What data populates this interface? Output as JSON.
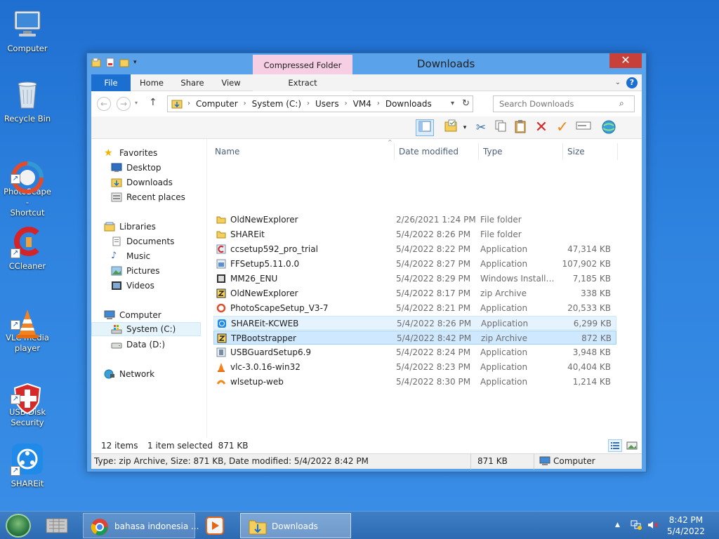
{
  "desktop": {
    "icons": [
      {
        "label": "Computer"
      },
      {
        "label": "Recycle Bin"
      },
      {
        "label": "PhotoScape -\nShortcut"
      },
      {
        "label": "CCleaner"
      },
      {
        "label": "VLC media\nplayer"
      },
      {
        "label": "USB Disk\nSecurity"
      },
      {
        "label": "SHAREit"
      }
    ]
  },
  "window": {
    "title": "Downloads",
    "context_tab": "Compressed Folder Tools",
    "tabs": {
      "file": "File",
      "home": "Home",
      "share": "Share",
      "view": "View",
      "extract": "Extract"
    },
    "help": "?",
    "close": "✕"
  },
  "address": {
    "crumbs": [
      "Computer",
      "System (C:)",
      "Users",
      "VM4",
      "Downloads"
    ],
    "search_placeholder": "Search Downloads"
  },
  "nav": {
    "favorites": "Favorites",
    "desktop": "Desktop",
    "downloads": "Downloads",
    "recent": "Recent places",
    "libraries": "Libraries",
    "documents": "Documents",
    "music": "Music",
    "pictures": "Pictures",
    "videos": "Videos",
    "computer": "Computer",
    "system_c": "System (C:)",
    "data_d": "Data (D:)",
    "network": "Network"
  },
  "columns": {
    "name": "Name",
    "date": "Date modified",
    "type": "Type",
    "size": "Size"
  },
  "files": [
    {
      "name": "OldNewExplorer",
      "date": "2/26/2021 1:24 PM",
      "type": "File folder",
      "size": ""
    },
    {
      "name": "SHAREit",
      "date": "5/4/2022 8:26 PM",
      "type": "File folder",
      "size": ""
    },
    {
      "name": "ccsetup592_pro_trial",
      "date": "5/4/2022 8:22 PM",
      "type": "Application",
      "size": "47,314 KB"
    },
    {
      "name": "FFSetup5.11.0.0",
      "date": "5/4/2022 8:27 PM",
      "type": "Application",
      "size": "107,902 KB"
    },
    {
      "name": "MM26_ENU",
      "date": "5/4/2022 8:29 PM",
      "type": "Windows Installer ...",
      "size": "7,185 KB"
    },
    {
      "name": "OldNewExplorer",
      "date": "5/4/2022 8:17 PM",
      "type": "zip Archive",
      "size": "338 KB"
    },
    {
      "name": "PhotoScapeSetup_V3-7",
      "date": "5/4/2022 8:21 PM",
      "type": "Application",
      "size": "20,533 KB"
    },
    {
      "name": "SHAREit-KCWEB",
      "date": "5/4/2022 8:26 PM",
      "type": "Application",
      "size": "6,299 KB"
    },
    {
      "name": "TPBootstrapper",
      "date": "5/4/2022 8:42 PM",
      "type": "zip Archive",
      "size": "872 KB"
    },
    {
      "name": "USBGuardSetup6.9",
      "date": "5/4/2022 8:24 PM",
      "type": "Application",
      "size": "3,948 KB"
    },
    {
      "name": "vlc-3.0.16-win32",
      "date": "5/4/2022 8:23 PM",
      "type": "Application",
      "size": "40,404 KB"
    },
    {
      "name": "wlsetup-web",
      "date": "5/4/2022 8:30 PM",
      "type": "Application",
      "size": "1,214 KB"
    }
  ],
  "status": {
    "items": "12 items",
    "selected": "1 item selected  871 KB",
    "details": "Type: zip Archive, Size: 871 KB, Date modified: 5/4/2022 8:42 PM",
    "size": "871 KB",
    "location": "Computer"
  },
  "taskbar": {
    "chrome": "bahasa indonesia ...",
    "downloads": "Downloads",
    "time": "8:42 PM",
    "date": "5/4/2022"
  },
  "colors": {
    "accent": "#1a6fd0",
    "close": "#c7413a",
    "selection": "#cde8ff"
  }
}
